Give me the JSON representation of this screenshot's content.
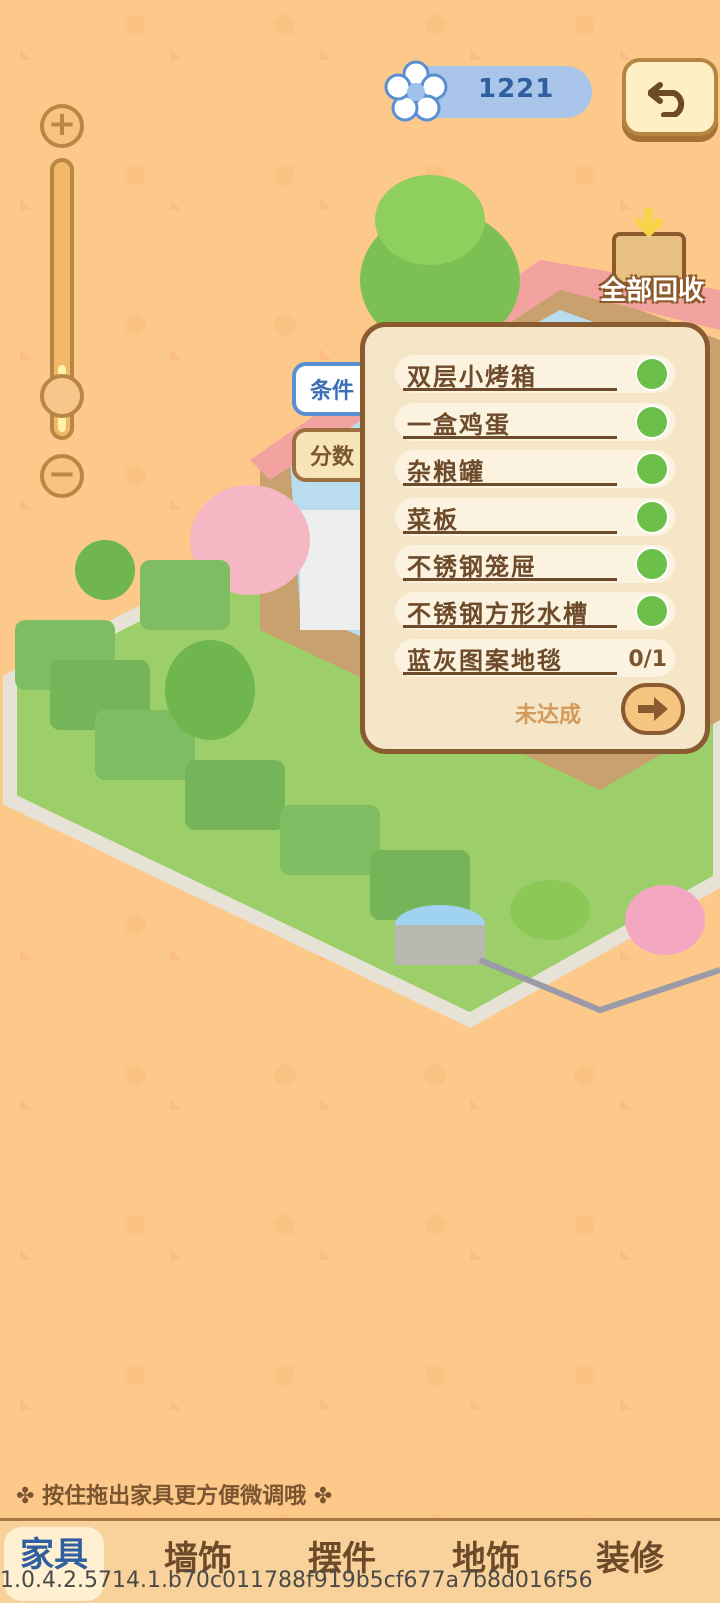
{
  "currency": {
    "amount": "1221",
    "icon": "flower-icon"
  },
  "buttons": {
    "back": "back-icon",
    "recycle_all_label": "全部回收"
  },
  "zoom": {
    "plus": "+",
    "minus": "−",
    "level": 0.25
  },
  "panel": {
    "tabs": [
      "条件",
      "分数"
    ],
    "active_tab": "条件",
    "conditions": [
      {
        "name": "双层小烤箱",
        "done": true
      },
      {
        "name": "一盒鸡蛋",
        "done": true
      },
      {
        "name": "杂粮罐",
        "done": true
      },
      {
        "name": "菜板",
        "done": true
      },
      {
        "name": "不锈钢笼屉",
        "done": true
      },
      {
        "name": "不锈钢方形水槽",
        "done": true
      },
      {
        "name": "蓝灰图案地毯",
        "done": false,
        "progress": "0/1"
      }
    ],
    "status": "未达成"
  },
  "hint": "按住拖出家具更方便微调哦",
  "nav": {
    "tabs": [
      "家具",
      "墙饰",
      "摆件",
      "地饰",
      "装修"
    ],
    "active": "家具"
  },
  "version": "1.0.4.2.5714.1.b70c011788f919b5cf677a7b8d016f56",
  "colors": {
    "background": "#fdc98a",
    "accent": "#2f5f9e",
    "check": "#6cc04a",
    "wood": "#8a5a30"
  }
}
